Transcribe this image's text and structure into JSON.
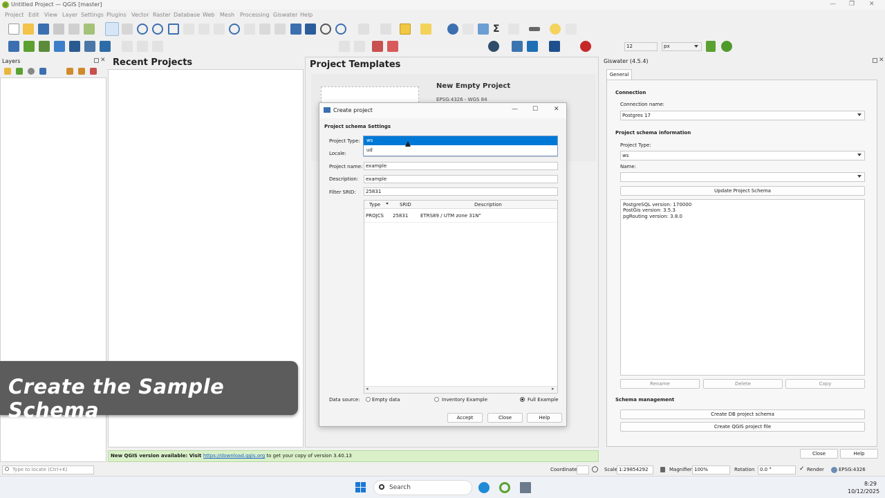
{
  "window": {
    "title": "Untitled Project — QGIS [master]",
    "controls": [
      "—",
      "❐",
      "✕"
    ]
  },
  "menu": [
    "Project",
    "Edit",
    "View",
    "Layer",
    "Settings",
    "Plugins",
    "Vector",
    "Raster",
    "Database",
    "Web",
    "Mesh",
    "Processing",
    "Giswater",
    "Help"
  ],
  "toolbar": {
    "scale_value": "12",
    "unit_value": "px"
  },
  "layers_panel": {
    "title": "Layers"
  },
  "welcome": {
    "recent_title": "Recent Projects",
    "templates_title": "Project Templates",
    "template_name": "New Empty Project",
    "template_crs": "EPSG:4326 - WGS 84",
    "update_prefix": "New QGIS version available: Visit ",
    "update_link": "https://download.qgis.org",
    "update_suffix": " to get your copy of version 3.40.13"
  },
  "dialog": {
    "title": "Create project",
    "section": "Project schema Settings",
    "project_type_label": "Project Type:",
    "dropdown_options": [
      "ws",
      "ud"
    ],
    "locale_label": "Locale:",
    "project_name_label": "Project name:",
    "project_name_value": "example",
    "description_label": "Description:",
    "description_value": "example",
    "filter_srid_label": "Filter SRID:",
    "filter_srid_value": "25831",
    "table_headers": [
      "Type",
      "SRID",
      "Description"
    ],
    "table_rows": [
      {
        "type": "PROJCS",
        "srid": "25831",
        "description": "ETRS89 / UTM zone 31N\""
      }
    ],
    "data_source_label": "Data source:",
    "radio_options": [
      "Empty data",
      "Inventory Example",
      "Full Example"
    ],
    "radio_selected": "Full Example",
    "buttons": [
      "Accept",
      "Close",
      "Help"
    ]
  },
  "giswater": {
    "title": "Giswater (4.5.4)",
    "tab": "General",
    "connection_title": "Connection",
    "connection_label": "Connection name:",
    "connection_value": "Postgres 17",
    "schema_info_title": "Project schema information",
    "project_type_label": "Project Type:",
    "project_type_value": "ws",
    "name_label": "Name:",
    "name_value": "",
    "update_button": "Update Project Schema",
    "info_lines": [
      "PostgreSQL version: 170000",
      "PostGis version: 3.5.3",
      "pgRouting version: 3.8.0"
    ],
    "rename_button": "Rename",
    "delete_button": "Delete",
    "copy_button": "Copy",
    "schema_mgmt_title": "Schema management",
    "create_db_button": "Create DB project schema",
    "create_qgis_button": "Create QGIS project file",
    "close_button": "Close",
    "help_button": "Help"
  },
  "statusbar": {
    "locate_placeholder": "Type to locate (Ctrl+K)",
    "coordinate_label": "Coordinate",
    "scale_label": "Scale",
    "scale_value": "1:29854292",
    "magnifier_label": "Magnifier",
    "magnifier_value": "100%",
    "rotation_label": "Rotation",
    "rotation_value": "0.0 °",
    "render_label": "Render",
    "crs_value": "EPSG:4326"
  },
  "overlay": {
    "caption": "Create the Sample Schema"
  },
  "taskbar": {
    "search_placeholder": "Search",
    "time": "8:29",
    "date": "10/12/2025"
  },
  "colors": {
    "accent": "#0078d7",
    "qgis_green": "#5aa132",
    "banner_bg": "#5c5c5c",
    "update_bg": "#d9f0c8"
  }
}
